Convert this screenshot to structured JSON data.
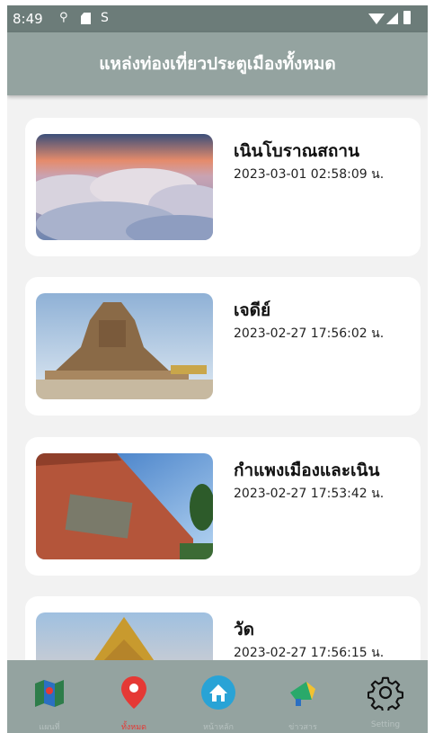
{
  "status_bar": {
    "time": "8:49"
  },
  "app_bar": {
    "title": "แหล่งท่องเที่ยวประตูเมืองทั้งหมด"
  },
  "places": [
    {
      "title": "เนินโบราณสถาน",
      "date": "2023-03-01 02:58:09 น.",
      "image": "clouds-sunset"
    },
    {
      "title": "เจดีย์",
      "date": "2023-02-27 17:56:02 น.",
      "image": "ancient-chedi"
    },
    {
      "title": "กำแพงเมืองและเนิน",
      "date": "2023-02-27 17:53:42 น.",
      "image": "city-wall"
    },
    {
      "title": "วัด",
      "date": "2023-02-27 17:56:15 น.",
      "image": "temple"
    }
  ],
  "bottom_nav": {
    "items": [
      {
        "label": "แผนที่",
        "icon": "map-icon",
        "active": false
      },
      {
        "label": "ทั้งหมด",
        "icon": "location-pin-icon",
        "active": true
      },
      {
        "label": "หน้าหลัก",
        "icon": "home-icon",
        "active": false
      },
      {
        "label": "ข่าวสาร",
        "icon": "megaphone-icon",
        "active": false
      },
      {
        "label": "Setting",
        "icon": "gear-icon",
        "active": false
      }
    ]
  },
  "colors": {
    "status_bar": "#6c7c79",
    "app_bar": "#94a3a0",
    "background": "#f2f2f2",
    "active_nav": "#e53935",
    "home_circle": "#29a3d6"
  }
}
